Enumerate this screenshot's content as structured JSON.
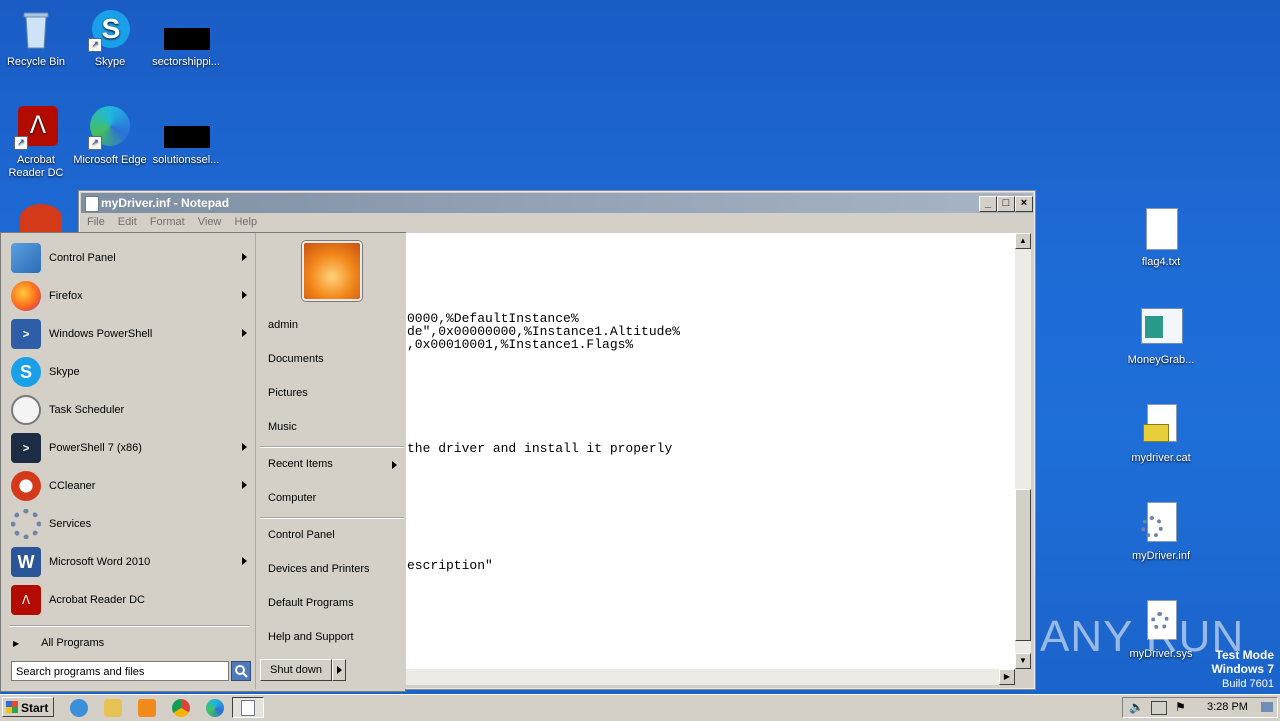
{
  "desktop": {
    "icons_left": [
      {
        "label": "Recycle Bin"
      },
      {
        "label": "Skype"
      },
      {
        "label": "sectorshippi..."
      },
      {
        "label": "Acrobat Reader DC"
      },
      {
        "label": "Microsoft Edge"
      },
      {
        "label": "solutionssel..."
      }
    ],
    "icons_right": [
      {
        "label": "flag4.txt"
      },
      {
        "label": "MoneyGrab..."
      },
      {
        "label": "mydriver.cat"
      },
      {
        "label": "myDriver.inf"
      },
      {
        "label": "myDriver.sys"
      }
    ],
    "watermark": {
      "text": "ANY RUN",
      "test_mode": "Test Mode",
      "os": "Windows 7",
      "build": "Build 7601"
    }
  },
  "notepad": {
    "title": "myDriver.inf - Notepad",
    "menu": [
      "File",
      "Edit",
      "Format",
      "View",
      "Help"
    ],
    "lines": [
      "0000,%DefaultInstance%",
      "de\",0x00000000,%Instance1.Altitude%",
      ",0x00010001,%Instance1.Flags%",
      "the driver and install it properly",
      "escription\""
    ]
  },
  "start_menu": {
    "programs": [
      {
        "label": "Control Panel",
        "icon": "control-panel-icon",
        "has_arrow": true
      },
      {
        "label": "Firefox",
        "icon": "firefox-icon",
        "has_arrow": true
      },
      {
        "label": "Windows PowerShell",
        "icon": "powershell-icon",
        "has_arrow": true
      },
      {
        "label": "Skype",
        "icon": "skype-icon",
        "has_arrow": false
      },
      {
        "label": "Task Scheduler",
        "icon": "clock-icon",
        "has_arrow": false
      },
      {
        "label": "PowerShell 7 (x86)",
        "icon": "powershell7-icon",
        "has_arrow": true
      },
      {
        "label": "CCleaner",
        "icon": "ccleaner-icon",
        "has_arrow": true
      },
      {
        "label": "Services",
        "icon": "gears-icon",
        "has_arrow": false
      },
      {
        "label": "Microsoft Word 2010",
        "icon": "word-icon",
        "has_arrow": true
      },
      {
        "label": "Acrobat Reader DC",
        "icon": "acrobat-icon",
        "has_arrow": false
      }
    ],
    "all_programs": "All Programs",
    "search_placeholder": "Search programs and files",
    "right_links": {
      "user": "admin",
      "documents": "Documents",
      "pictures": "Pictures",
      "music": "Music",
      "recent": "Recent Items",
      "computer": "Computer",
      "control_panel": "Control Panel",
      "devices": "Devices and Printers",
      "defaults": "Default Programs",
      "help": "Help and Support"
    },
    "shutdown": "Shut down"
  },
  "taskbar": {
    "start": "Start",
    "clock": "3:28 PM"
  }
}
